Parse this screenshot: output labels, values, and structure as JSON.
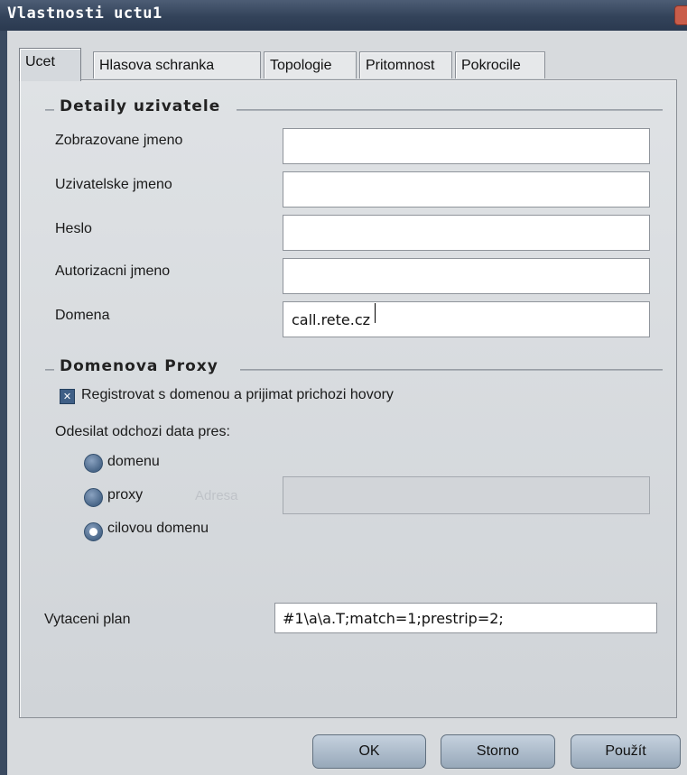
{
  "window": {
    "title": "Vlastnosti uctu1"
  },
  "tabs": [
    {
      "label": "Ucet",
      "active": true
    },
    {
      "label": "Hlasova schranka",
      "active": false
    },
    {
      "label": "Topologie",
      "active": false
    },
    {
      "label": "Pritomnost",
      "active": false
    },
    {
      "label": "Pokrocile",
      "active": false
    }
  ],
  "user_details": {
    "title": "Detaily uzivatele",
    "display_name": {
      "label": "Zobrazovane jmeno",
      "value": ""
    },
    "username": {
      "label": "Uzivatelske jmeno",
      "value": ""
    },
    "password": {
      "label": "Heslo",
      "value": ""
    },
    "auth_name": {
      "label": "Autorizacni jmeno",
      "value": ""
    },
    "domain": {
      "label": "Domena",
      "value": "call.rete.cz"
    }
  },
  "domain_proxy": {
    "title": "Domenova Proxy",
    "register_checkbox": {
      "label": "Registrovat s domenou a prijimat prichozi hovory",
      "checked": true
    },
    "send_via_label": "Odesilat odchozi data pres:",
    "options": [
      {
        "label": "domenu",
        "checked": false
      },
      {
        "label": "proxy",
        "checked": false
      },
      {
        "label": "cilovou domenu",
        "checked": true
      }
    ],
    "address": {
      "label": "Adresa",
      "value": "",
      "enabled": false
    }
  },
  "dial_plan": {
    "label": "Vytaceni plan",
    "value": "#1\\a\\a.T;match=1;prestrip=2;"
  },
  "buttons": {
    "ok": "OK",
    "cancel": "Storno",
    "apply": "Použít"
  }
}
